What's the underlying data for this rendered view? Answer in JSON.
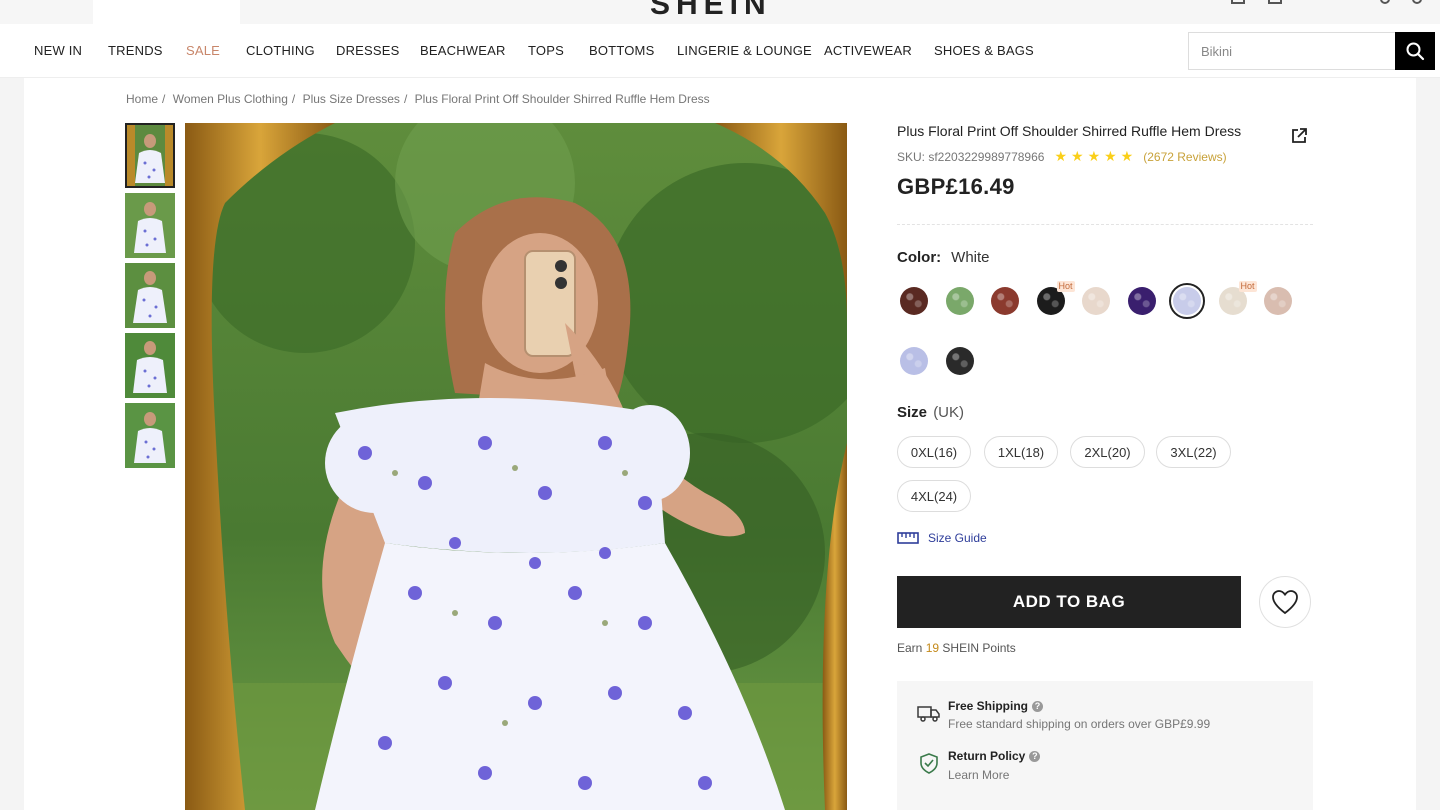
{
  "header": {
    "logo": "SHEIN"
  },
  "nav": {
    "items": [
      "NEW IN",
      "TRENDS",
      "SALE",
      "CLOTHING",
      "DRESSES",
      "BEACHWEAR",
      "TOPS",
      "BOTTOMS",
      "LINGERIE & LOUNGE",
      "ACTIVEWEAR",
      "SHOES & BAGS"
    ],
    "search_placeholder": "Bikini"
  },
  "breadcrumb": [
    "Home",
    "Women Plus Clothing",
    "Plus Size Dresses",
    "Plus Floral Print Off Shoulder Shirred Ruffle Hem Dress"
  ],
  "breadcrumb_separator": "/",
  "product": {
    "title": "Plus Floral Print Off Shoulder Shirred Ruffle Hem Dress",
    "sku": "SKU: sf2203229989778966",
    "stars": "★★★★★",
    "rating": 5,
    "reviews": "(2672 Reviews)",
    "price": "GBP£16.49",
    "color_label": "Color:",
    "color_value": "White",
    "swatches": [
      {
        "color": "#5a2a22",
        "hot": false
      },
      {
        "color": "#7aa86a",
        "hot": false
      },
      {
        "color": "#8b3a2e",
        "hot": false
      },
      {
        "color": "#1c1c1c",
        "hot": true
      },
      {
        "color": "#e8d8cc",
        "hot": false
      },
      {
        "color": "#3a1f6e",
        "hot": false
      },
      {
        "color": "#c8ccea",
        "hot": false,
        "selected": true
      },
      {
        "color": "#e6ddd0",
        "hot": true
      },
      {
        "color": "#d9bdb0",
        "hot": false
      },
      {
        "color": "#b9bfe6",
        "hot": false
      },
      {
        "color": "#2a2a2a",
        "hot": false
      }
    ],
    "hot_label": "Hot",
    "size_label": "Size",
    "size_unit": "(UK)",
    "sizes": [
      "0XL(16)",
      "1XL(18)",
      "2XL(20)",
      "3XL(22)",
      "4XL(24)"
    ],
    "size_guide": "Size Guide",
    "add_to_bag": "ADD TO BAG",
    "points_prefix": "Earn",
    "points_value": "19",
    "points_suffix": "SHEIN Points",
    "shipping_title": "Free Shipping",
    "shipping_sub": "Free standard shipping on orders over GBP£9.99",
    "return_title": "Return Policy",
    "return_sub": "Learn More"
  },
  "colors": {
    "accent_sale": "#c8866a",
    "button": "#222222",
    "star": "#facf19",
    "link": "#2e3d9a"
  }
}
